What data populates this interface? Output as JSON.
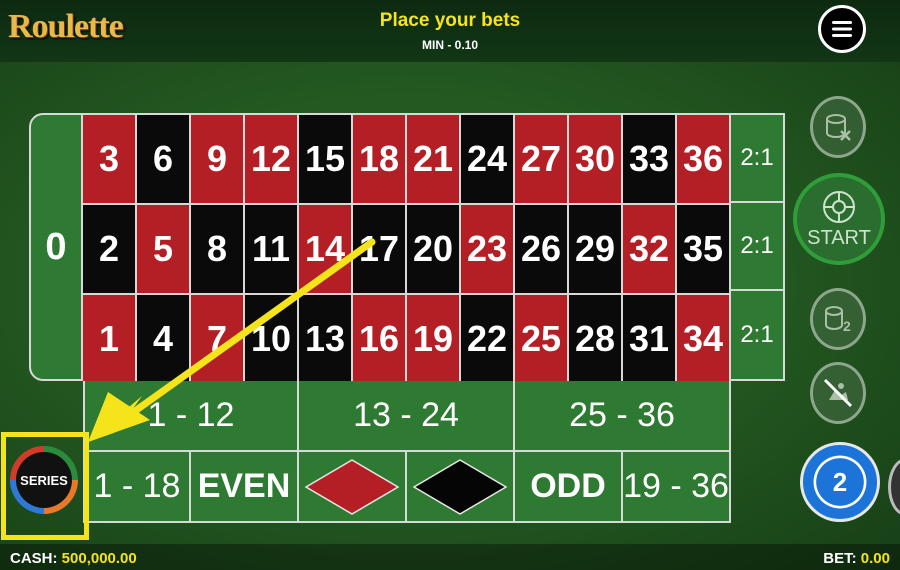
{
  "header": {
    "logo": "Roulette",
    "status": "Place your bets",
    "min_bet": "MIN - 0.10",
    "menu_icon": "hamburger-menu-icon"
  },
  "table": {
    "zero": "0",
    "rows": [
      [
        {
          "n": "3",
          "c": "red"
        },
        {
          "n": "6",
          "c": "black"
        },
        {
          "n": "9",
          "c": "red"
        },
        {
          "n": "12",
          "c": "red"
        },
        {
          "n": "15",
          "c": "black"
        },
        {
          "n": "18",
          "c": "red"
        },
        {
          "n": "21",
          "c": "red"
        },
        {
          "n": "24",
          "c": "black"
        },
        {
          "n": "27",
          "c": "red"
        },
        {
          "n": "30",
          "c": "red"
        },
        {
          "n": "33",
          "c": "black"
        },
        {
          "n": "36",
          "c": "red"
        }
      ],
      [
        {
          "n": "2",
          "c": "black"
        },
        {
          "n": "5",
          "c": "red"
        },
        {
          "n": "8",
          "c": "black"
        },
        {
          "n": "11",
          "c": "black"
        },
        {
          "n": "14",
          "c": "red"
        },
        {
          "n": "17",
          "c": "black"
        },
        {
          "n": "20",
          "c": "black"
        },
        {
          "n": "23",
          "c": "red"
        },
        {
          "n": "26",
          "c": "black"
        },
        {
          "n": "29",
          "c": "black"
        },
        {
          "n": "32",
          "c": "red"
        },
        {
          "n": "35",
          "c": "black"
        }
      ],
      [
        {
          "n": "1",
          "c": "red"
        },
        {
          "n": "4",
          "c": "black"
        },
        {
          "n": "7",
          "c": "red"
        },
        {
          "n": "10",
          "c": "black"
        },
        {
          "n": "13",
          "c": "black"
        },
        {
          "n": "16",
          "c": "red"
        },
        {
          "n": "19",
          "c": "red"
        },
        {
          "n": "22",
          "c": "black"
        },
        {
          "n": "25",
          "c": "red"
        },
        {
          "n": "28",
          "c": "black"
        },
        {
          "n": "31",
          "c": "black"
        },
        {
          "n": "34",
          "c": "red"
        }
      ]
    ],
    "column_bets": [
      "2:1",
      "2:1",
      "2:1"
    ],
    "dozens": [
      "1 - 12",
      "13 - 24",
      "25 - 36"
    ],
    "outside": {
      "low": "1 - 18",
      "even": "EVEN",
      "odd": "ODD",
      "high": "19 - 36"
    }
  },
  "controls": {
    "series": "SERIES",
    "start": "START",
    "chip_value": "2"
  },
  "footer": {
    "cash_label": "CASH:",
    "cash_value": "500,000.00",
    "bet_label": "BET:",
    "bet_value": "0.00"
  },
  "colors": {
    "felt": "#2f6a2a",
    "red": "#b31f24",
    "black": "#0a0a0a",
    "highlight": "#f4e419"
  }
}
